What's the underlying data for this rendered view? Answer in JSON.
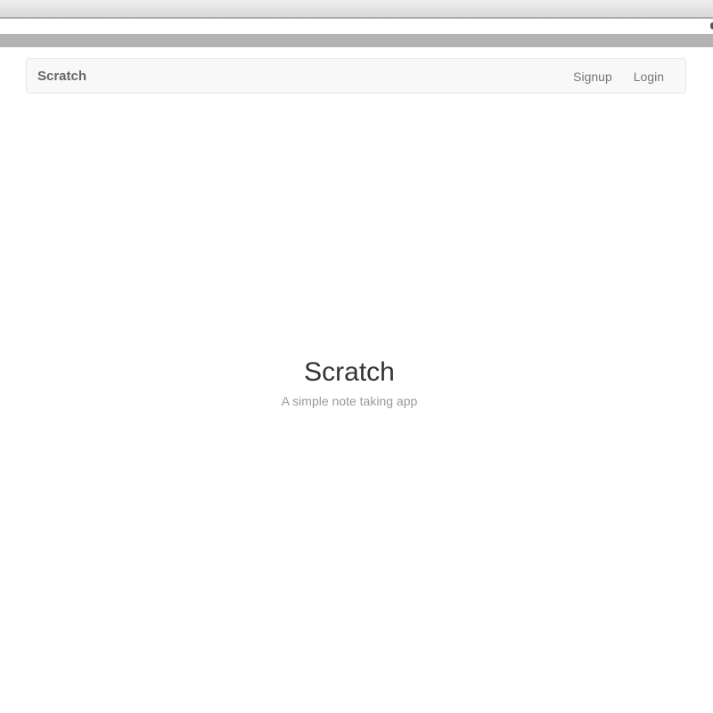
{
  "navbar": {
    "brand": "Scratch",
    "links": [
      "Signup",
      "Login"
    ]
  },
  "hero": {
    "title": "Scratch",
    "subtitle": "A simple note taking app"
  },
  "colors": {
    "navbar_bg": "#f8f8f8",
    "text_dark": "#333333",
    "text_muted": "#999999"
  }
}
